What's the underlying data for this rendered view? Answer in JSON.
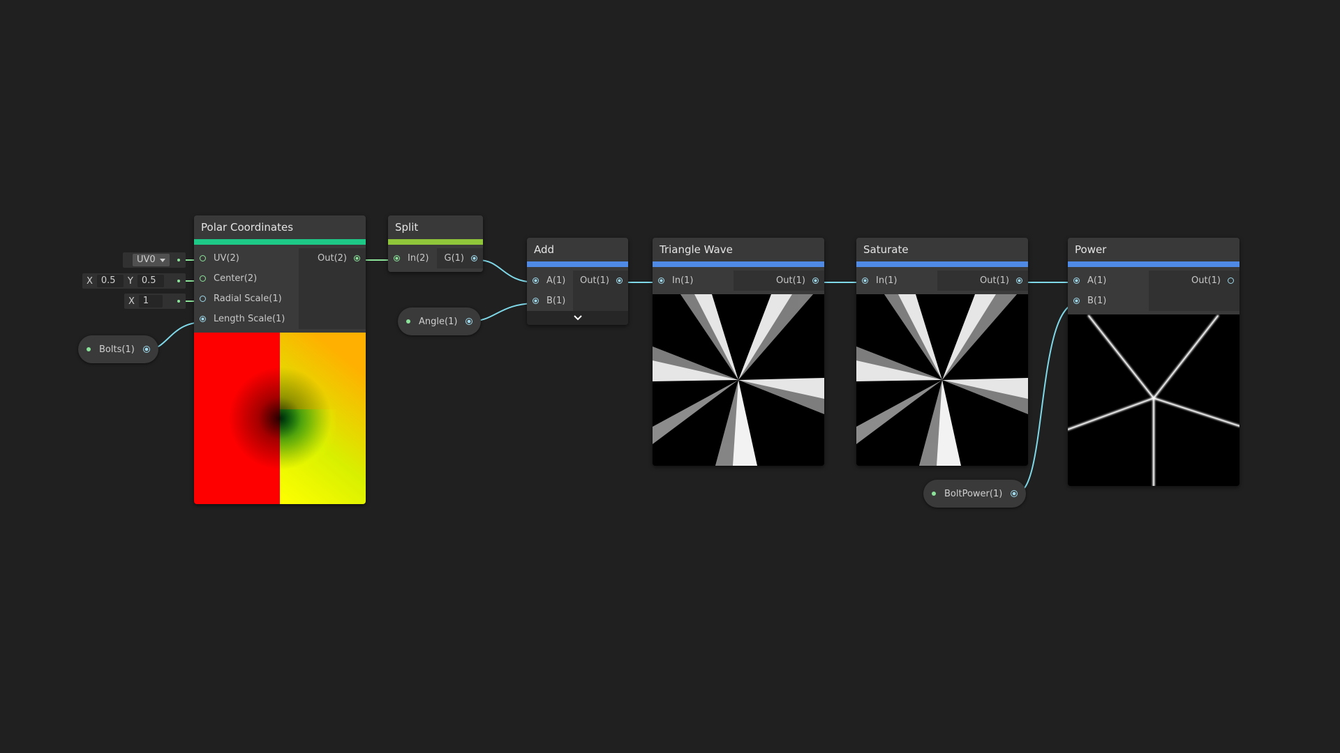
{
  "colors": {
    "background": "#202020",
    "bar_green": "#1ec987",
    "bar_lime": "#8fc63a",
    "bar_blue": "#4f8be6",
    "wire_green": "#8be39a",
    "wire_cyan": "#7fd8e8"
  },
  "nodes": {
    "polar": {
      "title": "Polar Coordinates",
      "inputs": [
        "UV(2)",
        "Center(2)",
        "Radial Scale(1)",
        "Length Scale(1)"
      ],
      "output": "Out(2)"
    },
    "split": {
      "title": "Split",
      "input": "In(2)",
      "output": "G(1)"
    },
    "add": {
      "title": "Add",
      "inputs": [
        "A(1)",
        "B(1)"
      ],
      "output": "Out(1)"
    },
    "triangle": {
      "title": "Triangle Wave",
      "input": "In(1)",
      "output": "Out(1)"
    },
    "saturate": {
      "title": "Saturate",
      "input": "In(1)",
      "output": "Out(1)"
    },
    "power": {
      "title": "Power",
      "inputs": [
        "A(1)",
        "B(1)"
      ],
      "output": "Out(1)"
    }
  },
  "inline_values": {
    "uv_channel": "UV0",
    "center_x_label": "X",
    "center_x": "0.5",
    "center_y_label": "Y",
    "center_y": "0.5",
    "radial_x_label": "X",
    "radial_x": "1"
  },
  "properties": {
    "bolts": "Bolts(1)",
    "angle": "Angle(1)",
    "bolt_power": "BoltPower(1)"
  }
}
